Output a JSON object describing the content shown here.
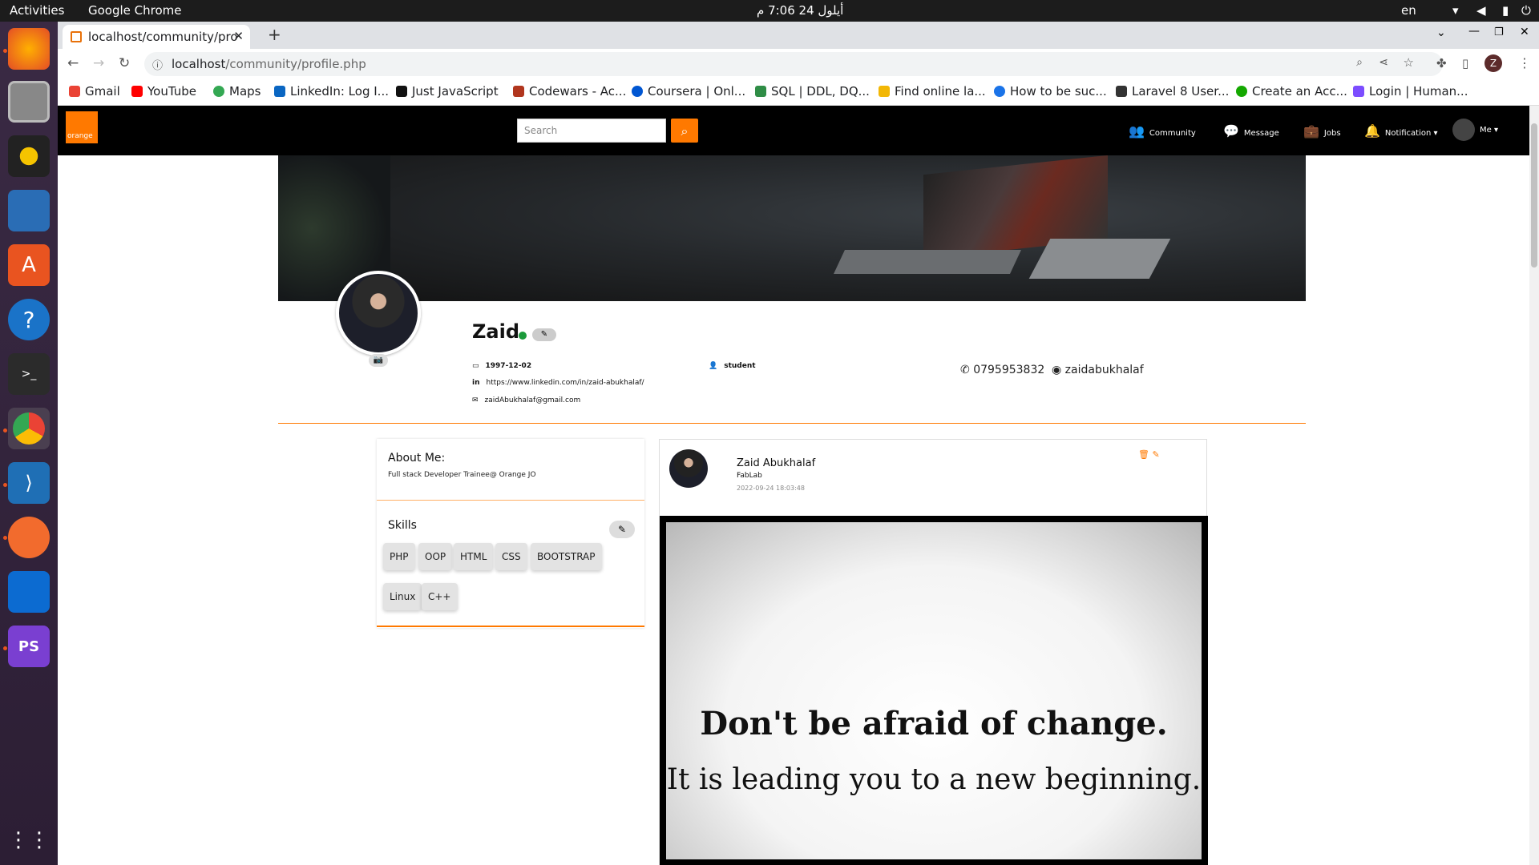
{
  "system": {
    "activities": "Activities",
    "app": "Google Chrome",
    "clock": "أيلول 24  7:06 م",
    "lang": "en"
  },
  "browser": {
    "tab_title": "localhost/community/pro",
    "url_host": "localhost",
    "url_path": "/community/profile.php",
    "bookmarks": [
      "Gmail",
      "YouTube",
      "Maps",
      "LinkedIn: Log I...",
      "Just JavaScript",
      "Codewars - Ac...",
      "Coursera | Onl...",
      "SQL | DDL, DQ...",
      "Find online la...",
      "How to be suc...",
      "Laravel 8 User...",
      "Create an Acc...",
      "Login | Human..."
    ]
  },
  "nav": {
    "logo": "orange",
    "search_placeholder": "Search",
    "links": [
      "Community",
      "Message",
      "Jobs",
      "Notification",
      "Me"
    ]
  },
  "profile": {
    "name": "Zaid",
    "birthdate": "1997-12-02",
    "linkedin": "https://www.linkedin.com/in/zaid-abukhalaf/",
    "email": "zaidAbukhalaf@gmail.com",
    "role": "student",
    "phone": "0795953832",
    "github": "zaidabukhalaf"
  },
  "about": {
    "title": "About Me:",
    "text": "Full stack Developer Trainee@ Orange JO"
  },
  "skills": {
    "title": "Skills",
    "items": [
      "PHP",
      "OOP",
      "HTML",
      "CSS",
      "BOOTSTRAP",
      "Linux",
      "C++"
    ]
  },
  "post": {
    "author": "Zaid Abukhalaf",
    "org": "FabLab",
    "date": "2022-09-24 18:03:48",
    "quote_line1": "Don't be afraid of change.",
    "quote_line2": "It is leading you to a new beginning."
  },
  "colors": {
    "accent": "#ff7900",
    "nav_bg": "#000000",
    "online": "#1b9a3a"
  }
}
